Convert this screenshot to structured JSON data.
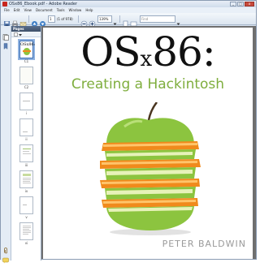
{
  "window": {
    "title": "OSx86_Ebook.pdf - Adobe Reader",
    "minimize": "_",
    "maximize": "□",
    "close": "x"
  },
  "menu": [
    "File",
    "Edit",
    "View",
    "Document",
    "Tools",
    "Window",
    "Help"
  ],
  "toolbar": {
    "page_current": "1",
    "page_total": "(1 of 978)",
    "zoom": "139%",
    "find_placeholder": "Find"
  },
  "panel": {
    "header": "Pages",
    "thumbnails": [
      {
        "label": "C1",
        "selected": true
      },
      {
        "label": "C2",
        "selected": false
      },
      {
        "label": "i",
        "selected": false
      },
      {
        "label": "ii",
        "selected": false
      },
      {
        "label": "iii",
        "selected": false
      },
      {
        "label": "iv",
        "selected": false
      },
      {
        "label": "v",
        "selected": false
      },
      {
        "label": "vi",
        "selected": false
      }
    ]
  },
  "document": {
    "title_big": "OS",
    "title_small": "x",
    "title_num": "86:",
    "subtitle": "Creating a Hackintosh",
    "author": "PETER BALDWIN"
  },
  "colors": {
    "subtitle_green": "#7fae3e",
    "apple_green": "#8cc43f",
    "orange": "#f08a1c"
  }
}
